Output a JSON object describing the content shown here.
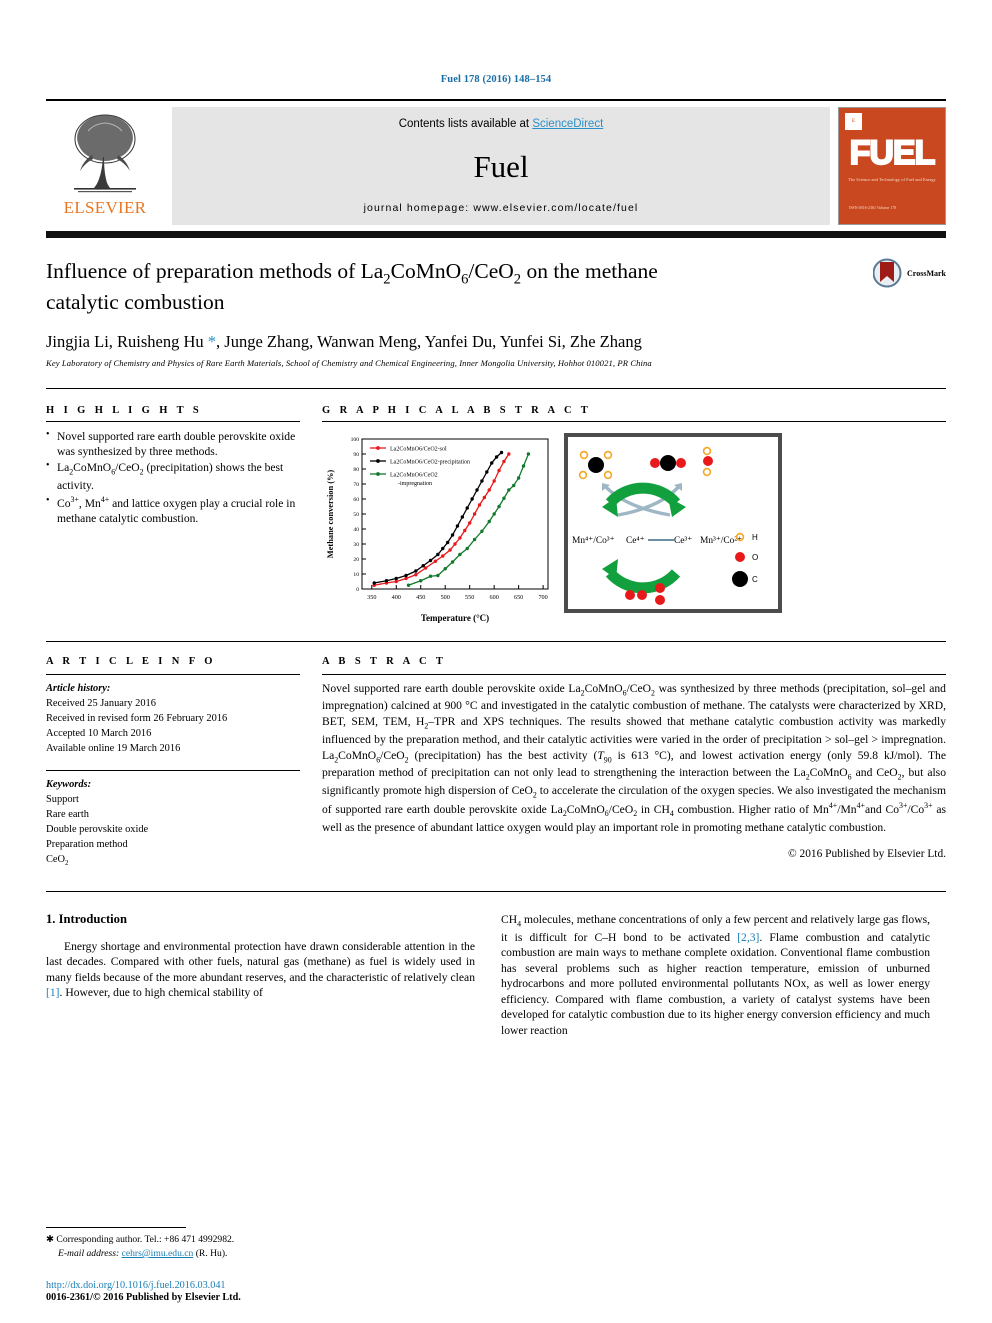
{
  "running_head": "Fuel 178 (2016) 148–154",
  "banner": {
    "contents_prefix": "Contents lists available at ",
    "sciencedirect": "ScienceDirect",
    "journal_name": "Fuel",
    "homepage": "journal homepage: www.elsevier.com/locate/fuel",
    "publisher": "ELSEVIER",
    "cover_title": "FUEL",
    "cover_subtitle": "The Science and Technology of Fuel and Energy",
    "cover_footer": "ISSN 0016-2361 Volume 178"
  },
  "article": {
    "title_line1": "Influence of preparation methods of La2CoMnO6/CeO2 on the methane",
    "title_line2": "catalytic combustion",
    "authors": "Jingjia Li, Ruisheng Hu *, Junge Zhang, Wanwan Meng, Yanfei Du, Yunfei Si, Zhe Zhang",
    "affiliation": "Key Laboratory of Chemistry and Physics of Rare Earth Materials, School of Chemistry and Chemical Engineering, Inner Mongolia University, Hohhot 010021, PR China",
    "crossmark_label": "CrossMark"
  },
  "highlights": {
    "heading": "H I G H L I G H T S",
    "items": [
      "Novel supported rare earth double perovskite oxide was synthesized by three methods.",
      "La2CoMnO6/CeO2 (precipitation) shows the best activity.",
      "Co3+, Mn4+ and lattice oxygen play a crucial role in methane catalytic combustion."
    ]
  },
  "graphical_abstract": {
    "heading": "G R A P H I C A L   A B S T R A C T",
    "schematic": {
      "left_species": "Mn4+/Co3+",
      "ce_left": "Ce4+",
      "ce_right": "Ce3+",
      "right_species": "Mn3+/Co2+",
      "legend": [
        {
          "symbol": "H",
          "color": "#f5a623"
        },
        {
          "symbol": "O",
          "color": "#e8191b"
        },
        {
          "symbol": "C",
          "color": "#000000"
        }
      ]
    }
  },
  "chart_data": {
    "type": "line",
    "title": "",
    "xlabel": "Temperature (°C)",
    "ylabel": "Methane conversion (%)",
    "xlim": [
      330,
      710
    ],
    "ylim": [
      0,
      100
    ],
    "xticks": [
      350,
      400,
      450,
      500,
      550,
      600,
      650,
      700
    ],
    "yticks": [
      0,
      10,
      20,
      30,
      40,
      50,
      60,
      70,
      80,
      90,
      100
    ],
    "grid": false,
    "legend_position": "upper-left",
    "series": [
      {
        "name": "La2CoMnO6/CeO2-sol",
        "color": "#e8191b",
        "x": [
          355,
          380,
          400,
          420,
          440,
          460,
          480,
          495,
          510,
          520,
          530,
          540,
          550,
          560,
          570,
          580,
          590,
          600,
          610,
          620,
          630
        ],
        "y": [
          2.5,
          4.0,
          5.0,
          7.0,
          9.5,
          14.0,
          18.5,
          22.0,
          26.0,
          30.0,
          34.0,
          39.0,
          44.0,
          50.0,
          56.0,
          61.0,
          66.0,
          72.0,
          79.0,
          85.0,
          90.0
        ]
      },
      {
        "name": "La2CoMnO6/CeO2-precipitation",
        "color": "#000000",
        "x": [
          355,
          380,
          400,
          420,
          440,
          455,
          470,
          485,
          495,
          505,
          515,
          525,
          535,
          545,
          555,
          565,
          575,
          585,
          595,
          605,
          615
        ],
        "y": [
          4.0,
          5.5,
          7.0,
          9.0,
          12.0,
          15.5,
          19.0,
          23.0,
          27.0,
          31.0,
          36.0,
          42.0,
          48.0,
          54.0,
          60.0,
          66.0,
          72.0,
          78.0,
          84.0,
          88.0,
          91.0
        ]
      },
      {
        "name": "La2CoMnO6/CeO2 -impregnation",
        "color": "#137a2b",
        "x": [
          425,
          450,
          470,
          485,
          500,
          515,
          530,
          545,
          560,
          575,
          590,
          600,
          610,
          620,
          630,
          640,
          650,
          660,
          670
        ],
        "y": [
          2.5,
          5.5,
          8.5,
          9.0,
          13.5,
          18.0,
          23.0,
          27.0,
          33.0,
          38.5,
          45.0,
          50.0,
          55.0,
          60.5,
          66.0,
          69.0,
          74.0,
          82.0,
          90.0
        ]
      }
    ]
  },
  "article_info": {
    "heading": "A R T I C L E   I N F O",
    "history_label": "Article history:",
    "history": [
      "Received 25 January 2016",
      "Received in revised form 26 February 2016",
      "Accepted 10 March 2016",
      "Available online 19 March 2016"
    ],
    "keywords_label": "Keywords:",
    "keywords": [
      "Support",
      "Rare earth",
      "Double perovskite oxide",
      "Preparation method",
      "CeO2"
    ]
  },
  "abstract": {
    "heading": "A B S T R A C T",
    "copyright": "© 2016 Published by Elsevier Ltd."
  },
  "introduction": {
    "heading": "1. Introduction"
  },
  "footnote": {
    "corresponding": "✱ Corresponding author. Tel.: +86 471 4992982.",
    "email_label": "E-mail address:",
    "email": "cehrs@imu.edu.cn",
    "email_owner": "(R. Hu)."
  },
  "footer": {
    "doi": "http://dx.doi.org/10.1016/j.fuel.2016.03.041",
    "issn": "0016-2361/© 2016 Published by Elsevier Ltd."
  },
  "colors": {
    "link": "#1a7fb5",
    "elsevier_orange": "#E87722",
    "cover_red": "#c9481f"
  }
}
